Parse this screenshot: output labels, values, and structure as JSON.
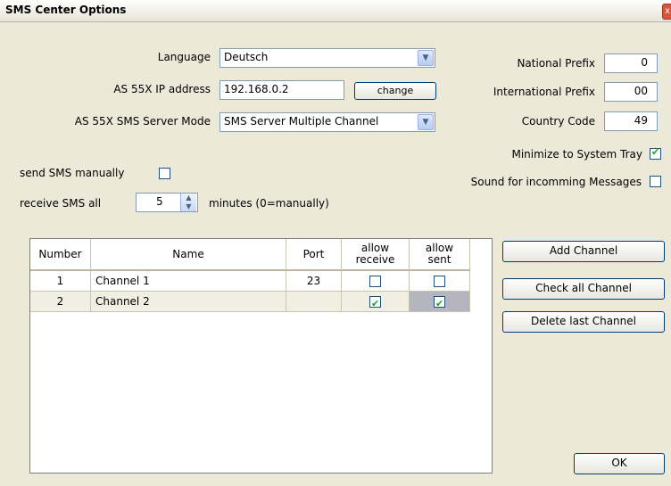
{
  "window": {
    "title": "SMS Center Options",
    "close_glyph": "x"
  },
  "language": {
    "label": "Language",
    "value": "Deutsch"
  },
  "ip": {
    "label": "AS 55X IP address",
    "value": "192.168.0.2",
    "change_button": "change"
  },
  "server_mode": {
    "label": "AS 55X SMS Server Mode",
    "value": "SMS Server Multiple Channel"
  },
  "national_prefix": {
    "label": "National Prefix",
    "value": "0"
  },
  "international_prefix": {
    "label": "International Prefix",
    "value": "00"
  },
  "country_code": {
    "label": "Country Code",
    "value": "49"
  },
  "minimize_tray": {
    "label": "Minimize to System Tray",
    "checked": true
  },
  "sound": {
    "label": "Sound for incomming Messages",
    "checked": false
  },
  "send_manual": {
    "label": "send SMS manually",
    "checked": false
  },
  "receive": {
    "label": "receive SMS all",
    "value": "5",
    "suffix": "minutes (0=manually)"
  },
  "table": {
    "columns": [
      "Number",
      "Name",
      "Port",
      "allow receive",
      "allow sent"
    ],
    "rows": [
      {
        "number": "1",
        "name": "Channel 1",
        "port": "23",
        "allow_receive": false,
        "allow_sent": false
      },
      {
        "number": "2",
        "name": "Channel 2",
        "port": "",
        "allow_receive": true,
        "allow_sent": true
      }
    ]
  },
  "buttons": {
    "add": "Add Channel",
    "check_all": "Check all Channel",
    "delete_last": "Delete last Channel",
    "ok": "OK"
  },
  "colors": {
    "selected_row": "#f1efe2",
    "active_cell": "#b5b5c0",
    "check": "#21a121"
  }
}
